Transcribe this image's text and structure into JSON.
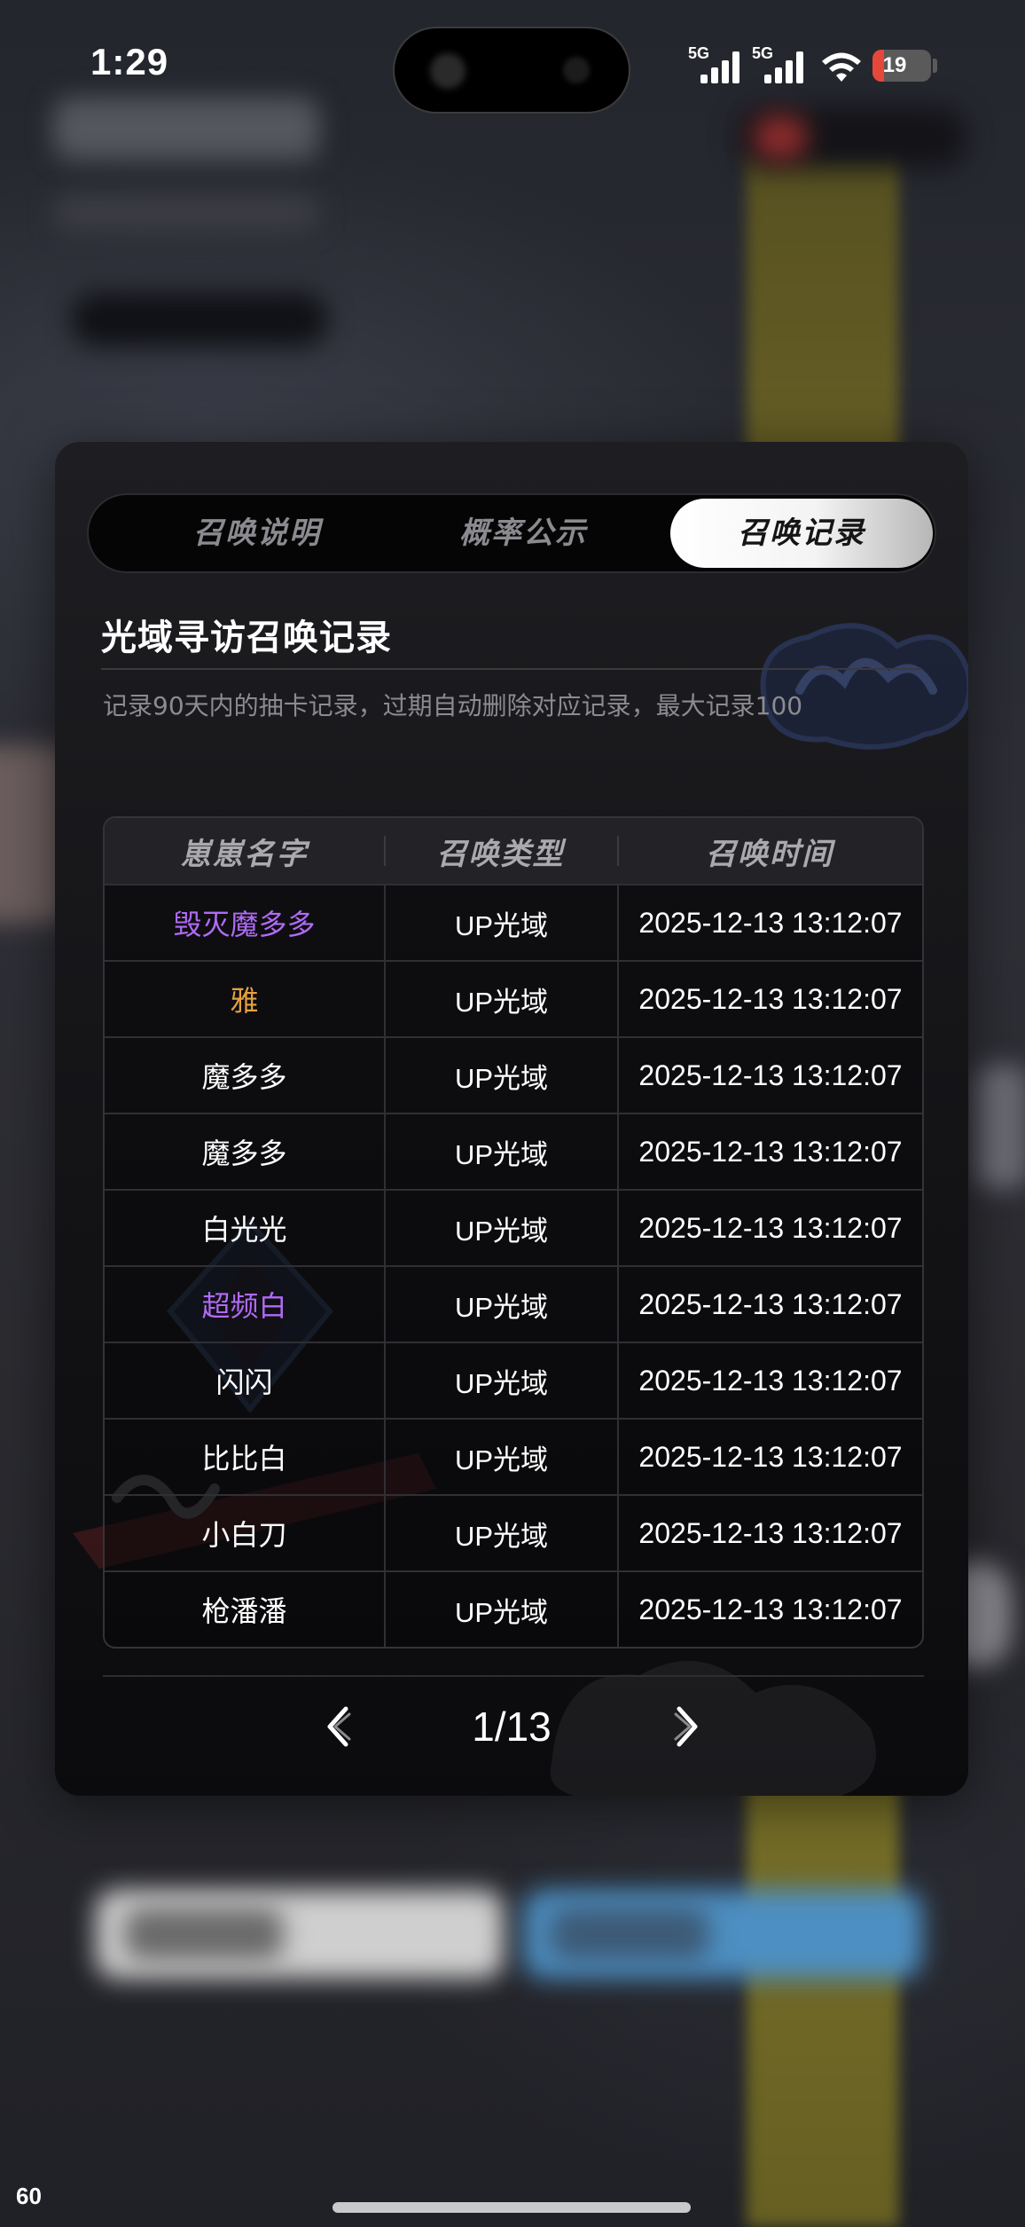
{
  "status_bar": {
    "time": "1:29",
    "network_1": "5G",
    "network_2": "5G",
    "battery": "19",
    "battery_level": 0.19
  },
  "tabs": [
    {
      "label": "召唤说明",
      "active": false
    },
    {
      "label": "概率公示",
      "active": false
    },
    {
      "label": "召唤记录",
      "active": true
    }
  ],
  "section": {
    "title": "光域寻访召唤记录",
    "description": "记录90天内的抽卡记录，过期自动删除对应记录，最大记录100"
  },
  "table": {
    "headers": [
      "崽崽名字",
      "召唤类型",
      "召唤时间"
    ],
    "rows": [
      {
        "name": "毁灭魔多多",
        "type": "UP光域",
        "time": "2025-12-13 13:12:07",
        "name_color": "#b06bf5"
      },
      {
        "name": "雅",
        "type": "UP光域",
        "time": "2025-12-13 13:12:07",
        "name_color": "#e8a13c"
      },
      {
        "name": "魔多多",
        "type": "UP光域",
        "time": "2025-12-13 13:12:07",
        "name_color": "#ffffff"
      },
      {
        "name": "魔多多",
        "type": "UP光域",
        "time": "2025-12-13 13:12:07",
        "name_color": "#ffffff"
      },
      {
        "name": "白光光",
        "type": "UP光域",
        "time": "2025-12-13 13:12:07",
        "name_color": "#ffffff"
      },
      {
        "name": "超频白",
        "type": "UP光域",
        "time": "2025-12-13 13:12:07",
        "name_color": "#b06bf5"
      },
      {
        "name": "闪闪",
        "type": "UP光域",
        "time": "2025-12-13 13:12:07",
        "name_color": "#ffffff"
      },
      {
        "name": "比比白",
        "type": "UP光域",
        "time": "2025-12-13 13:12:07",
        "name_color": "#ffffff"
      },
      {
        "name": "小白刀",
        "type": "UP光域",
        "time": "2025-12-13 13:12:07",
        "name_color": "#ffffff"
      },
      {
        "name": "枪潘潘",
        "type": "UP光域",
        "time": "2025-12-13 13:12:07",
        "name_color": "#ffffff"
      }
    ]
  },
  "pagination": {
    "label": "1/13",
    "prev_icon": "chevron-left-icon",
    "next_icon": "chevron-right-icon"
  },
  "overlay": {
    "fps": "60"
  },
  "colors": {
    "rare_purple": "#b06bf5",
    "rare_orange": "#e8a13c",
    "battery_low": "#e5483a"
  }
}
